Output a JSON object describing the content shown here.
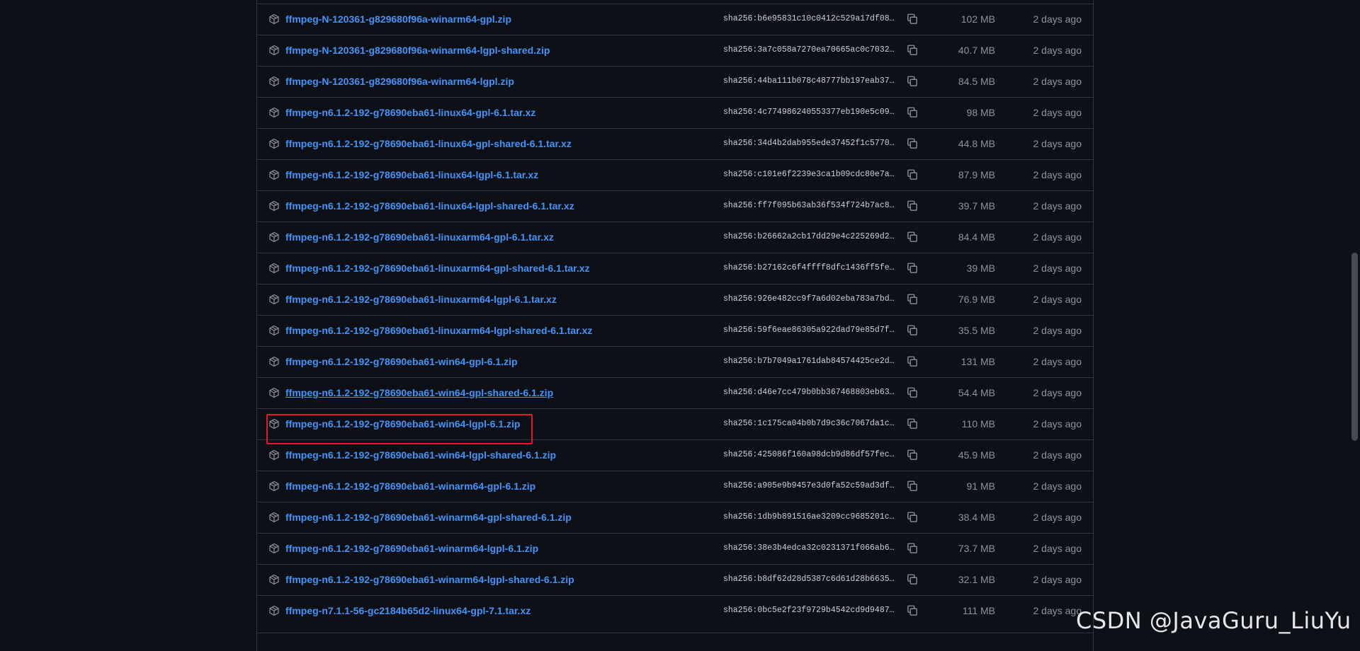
{
  "assets": [
    {
      "name": "ffmpeg-N-120361-g829680f96a-winarm64-gpl.zip",
      "sha": "sha256:b6e95831c10c0412c529a17df086f",
      "size": "102 MB",
      "date": "2 days ago"
    },
    {
      "name": "ffmpeg-N-120361-g829680f96a-winarm64-lgpl-shared.zip",
      "sha": "sha256:3a7c058a7270ea70665ac0c7032f7",
      "size": "40.7 MB",
      "date": "2 days ago"
    },
    {
      "name": "ffmpeg-N-120361-g829680f96a-winarm64-lgpl.zip",
      "sha": "sha256:44ba111b078c48777bb197eab37db",
      "size": "84.5 MB",
      "date": "2 days ago"
    },
    {
      "name": "ffmpeg-n6.1.2-192-g78690eba61-linux64-gpl-6.1.tar.xz",
      "sha": "sha256:4c774986240553377eb190e5c099d",
      "size": "98 MB",
      "date": "2 days ago"
    },
    {
      "name": "ffmpeg-n6.1.2-192-g78690eba61-linux64-gpl-shared-6.1.tar.xz",
      "sha": "sha256:34d4b2dab955ede37452f1c577084",
      "size": "44.8 MB",
      "date": "2 days ago"
    },
    {
      "name": "ffmpeg-n6.1.2-192-g78690eba61-linux64-lgpl-6.1.tar.xz",
      "sha": "sha256:c101e6f2239e3ca1b09cdc80e7a97",
      "size": "87.9 MB",
      "date": "2 days ago"
    },
    {
      "name": "ffmpeg-n6.1.2-192-g78690eba61-linux64-lgpl-shared-6.1.tar.xz",
      "sha": "sha256:ff7f095b63ab36f534f724b7ac84e",
      "size": "39.7 MB",
      "date": "2 days ago"
    },
    {
      "name": "ffmpeg-n6.1.2-192-g78690eba61-linuxarm64-gpl-6.1.tar.xz",
      "sha": "sha256:b26662a2cb17dd29e4c225269d2d7",
      "size": "84.4 MB",
      "date": "2 days ago"
    },
    {
      "name": "ffmpeg-n6.1.2-192-g78690eba61-linuxarm64-gpl-shared-6.1.tar.xz",
      "sha": "sha256:b27162c6f4ffff8dfc1436ff5fef9",
      "size": "39 MB",
      "date": "2 days ago"
    },
    {
      "name": "ffmpeg-n6.1.2-192-g78690eba61-linuxarm64-lgpl-6.1.tar.xz",
      "sha": "sha256:926e482cc9f7a6d02eba783a7bd64",
      "size": "76.9 MB",
      "date": "2 days ago"
    },
    {
      "name": "ffmpeg-n6.1.2-192-g78690eba61-linuxarm64-lgpl-shared-6.1.tar.xz",
      "sha": "sha256:59f6eae86305a922dad79e85d7f33",
      "size": "35.5 MB",
      "date": "2 days ago"
    },
    {
      "name": "ffmpeg-n6.1.2-192-g78690eba61-win64-gpl-6.1.zip",
      "sha": "sha256:b7b7049a1761dab84574425ce2d46",
      "size": "131 MB",
      "date": "2 days ago"
    },
    {
      "name": "ffmpeg-n6.1.2-192-g78690eba61-win64-gpl-shared-6.1.zip",
      "sha": "sha256:d46e7cc479b0bb367468803eb63e3",
      "size": "54.4 MB",
      "date": "2 days ago"
    },
    {
      "name": "ffmpeg-n6.1.2-192-g78690eba61-win64-lgpl-6.1.zip",
      "sha": "sha256:1c175ca04b0b7d9c36c7067da1c8c",
      "size": "110 MB",
      "date": "2 days ago"
    },
    {
      "name": "ffmpeg-n6.1.2-192-g78690eba61-win64-lgpl-shared-6.1.zip",
      "sha": "sha256:425086f160a98dcb9d86df57fecea",
      "size": "45.9 MB",
      "date": "2 days ago"
    },
    {
      "name": "ffmpeg-n6.1.2-192-g78690eba61-winarm64-gpl-6.1.zip",
      "sha": "sha256:a905e9b9457e3d0fa52c59ad3df10",
      "size": "91 MB",
      "date": "2 days ago"
    },
    {
      "name": "ffmpeg-n6.1.2-192-g78690eba61-winarm64-gpl-shared-6.1.zip",
      "sha": "sha256:1db9b891516ae3209cc9685201c5f",
      "size": "38.4 MB",
      "date": "2 days ago"
    },
    {
      "name": "ffmpeg-n6.1.2-192-g78690eba61-winarm64-lgpl-6.1.zip",
      "sha": "sha256:38e3b4edca32c0231371f066ab678",
      "size": "73.7 MB",
      "date": "2 days ago"
    },
    {
      "name": "ffmpeg-n6.1.2-192-g78690eba61-winarm64-lgpl-shared-6.1.zip",
      "sha": "sha256:b8df62d28d5387c6d61d28b6635eb",
      "size": "32.1 MB",
      "date": "2 days ago"
    },
    {
      "name": "ffmpeg-n7.1.1-56-gc2184b65d2-linux64-gpl-7.1.tar.xz",
      "sha": "sha256:0bc5e2f23f9729b4542cd9d94877e",
      "size": "111 MB",
      "date": "2 days ago"
    }
  ],
  "hovered_index": 12,
  "highlighted_index": 13,
  "watermark": "CSDN @JavaGuru_LiuYu",
  "colors": {
    "background": "#0d1117",
    "border": "#30363d",
    "link": "#4493f8",
    "muted": "#8b949e",
    "highlight": "#e5172d"
  },
  "icons": {
    "asset": "package-icon",
    "copy": "copy-icon"
  }
}
